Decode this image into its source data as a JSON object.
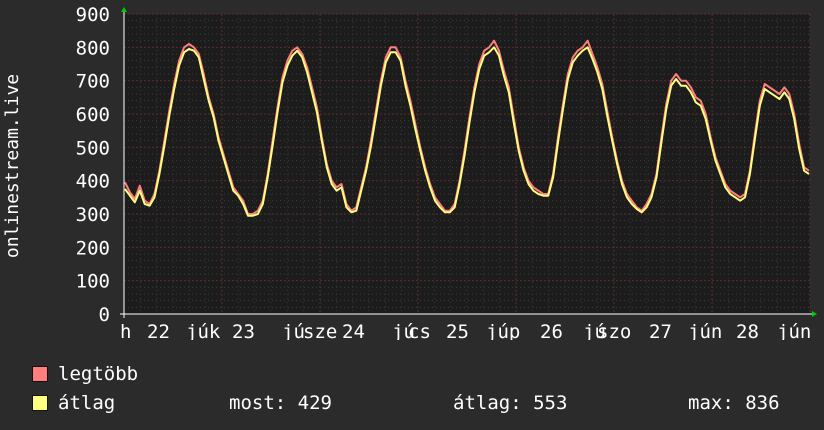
{
  "chart_data": {
    "type": "line",
    "ylabel": "onlinestream.live",
    "ylim": [
      0,
      900
    ],
    "grid": true,
    "yticks": [
      "900",
      "800",
      "700",
      "600",
      "500",
      "400",
      "300",
      "200",
      "100",
      "0"
    ],
    "xticks": [
      "h",
      "22",
      "júk",
      "23",
      "jú",
      "sze",
      "24",
      "jú",
      "cs",
      "25",
      "júp",
      "26",
      "jú",
      "szo",
      "27",
      "jún",
      "28",
      "jún"
    ],
    "series": [
      {
        "name": "legtöbb",
        "color": "#ff7f7f",
        "values": [
          395,
          365,
          345,
          385,
          340,
          330,
          360,
          430,
          520,
          610,
          690,
          760,
          800,
          810,
          800,
          780,
          720,
          650,
          600,
          530,
          480,
          430,
          380,
          360,
          340,
          300,
          300,
          310,
          340,
          420,
          520,
          620,
          710,
          760,
          790,
          800,
          780,
          740,
          680,
          620,
          530,
          450,
          400,
          380,
          390,
          330,
          310,
          320,
          380,
          440,
          520,
          610,
          700,
          770,
          800,
          800,
          770,
          700,
          640,
          570,
          500,
          440,
          390,
          350,
          330,
          310,
          310,
          330,
          400,
          490,
          590,
          680,
          750,
          790,
          800,
          820,
          790,
          730,
          680,
          590,
          500,
          440,
          400,
          380,
          370,
          360,
          360,
          420,
          530,
          630,
          720,
          770,
          790,
          800,
          820,
          780,
          740,
          690,
          610,
          530,
          460,
          400,
          360,
          340,
          320,
          310,
          330,
          360,
          420,
          530,
          630,
          700,
          720,
          700,
          700,
          680,
          650,
          640,
          600,
          530,
          470,
          430,
          390,
          370,
          360,
          350,
          360,
          430,
          540,
          640,
          690,
          680,
          670,
          660,
          680,
          660,
          600,
          510,
          440,
          430
        ]
      },
      {
        "name": "átlag",
        "color": "#ffff7f",
        "values": [
          375,
          355,
          335,
          370,
          330,
          325,
          350,
          420,
          505,
          595,
          675,
          745,
          785,
          795,
          790,
          770,
          705,
          640,
          590,
          520,
          470,
          420,
          370,
          355,
          330,
          295,
          295,
          300,
          330,
          410,
          505,
          605,
          695,
          745,
          775,
          790,
          770,
          725,
          665,
          605,
          520,
          440,
          390,
          370,
          380,
          320,
          305,
          310,
          370,
          430,
          505,
          595,
          685,
          755,
          785,
          785,
          760,
          685,
          625,
          555,
          490,
          430,
          380,
          340,
          320,
          305,
          305,
          320,
          390,
          475,
          575,
          665,
          735,
          775,
          785,
          800,
          775,
          715,
          665,
          575,
          490,
          430,
          390,
          370,
          360,
          355,
          355,
          410,
          515,
          615,
          705,
          755,
          775,
          790,
          800,
          765,
          725,
          675,
          595,
          520,
          450,
          390,
          350,
          330,
          315,
          305,
          320,
          350,
          410,
          515,
          615,
          685,
          705,
          685,
          685,
          665,
          635,
          625,
          585,
          520,
          460,
          420,
          380,
          360,
          350,
          340,
          350,
          420,
          525,
          625,
          675,
          665,
          655,
          645,
          665,
          645,
          585,
          495,
          430,
          420
        ]
      }
    ]
  },
  "legend": [
    {
      "label": "legtöbb",
      "color": "#ff7f7f"
    },
    {
      "label": "átlag",
      "color": "#ffff7f"
    }
  ],
  "stats": {
    "most": "most: 429",
    "atlag": "átlag: 553",
    "max": "max: 836"
  }
}
